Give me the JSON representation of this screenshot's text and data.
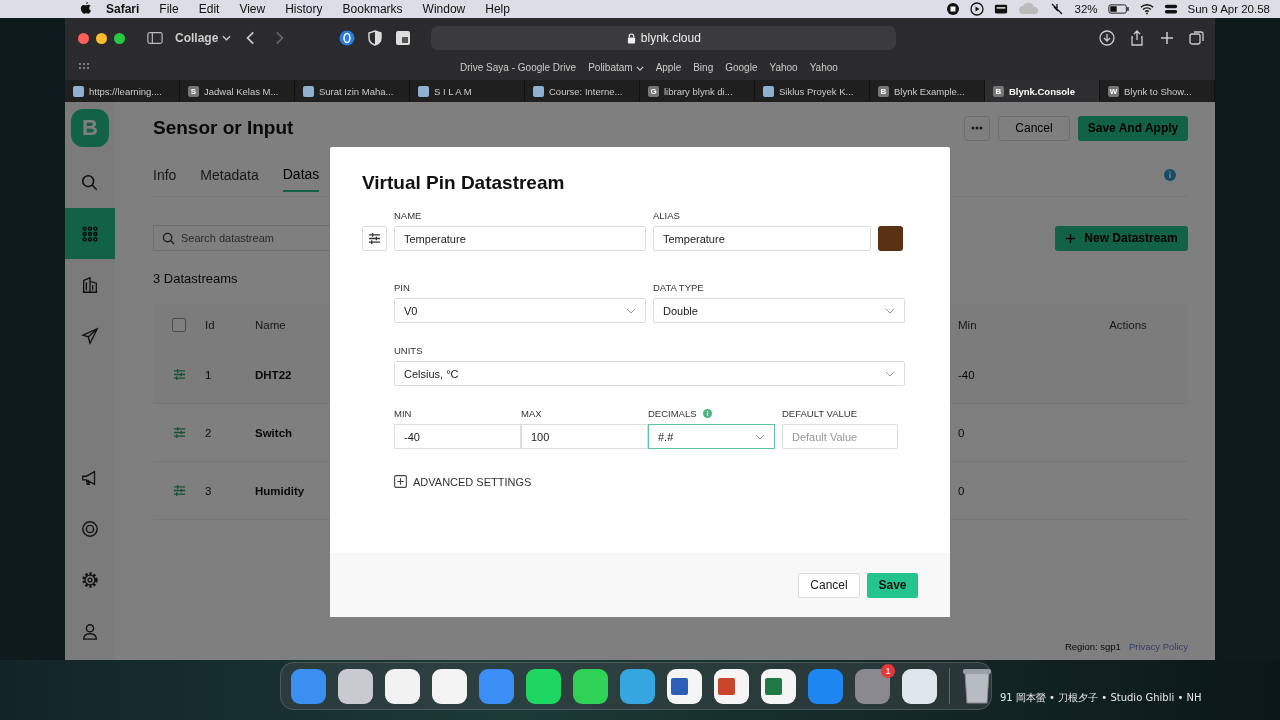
{
  "menu_bar": {
    "app": "Safari",
    "items": [
      "File",
      "Edit",
      "View",
      "History",
      "Bookmarks",
      "Window",
      "Help"
    ],
    "battery": "32%",
    "clock": "Sun 9 Apr 20.58"
  },
  "browser": {
    "profile": "Collage",
    "address": "blynk.cloud",
    "bookmarks": [
      {
        "label": "Drive Saya - Google Drive",
        "kind": "link"
      },
      {
        "label": "Polibatam",
        "kind": "folder"
      },
      {
        "label": "Apple",
        "kind": "link"
      },
      {
        "label": "Bing",
        "kind": "link"
      },
      {
        "label": "Google",
        "kind": "link"
      },
      {
        "label": "Yahoo",
        "kind": "link"
      },
      {
        "label": "Yahoo",
        "kind": "link"
      }
    ],
    "tabs": [
      {
        "label": "https://learning....",
        "selected": false
      },
      {
        "label": "Jadwal Kelas M...",
        "icon_text": "S",
        "selected": false
      },
      {
        "label": "Surat Izin Maha...",
        "selected": false
      },
      {
        "label": "S I L A M",
        "selected": false
      },
      {
        "label": "Course: Interne...",
        "selected": false
      },
      {
        "label": "library blynk di...",
        "icon_text": "G",
        "selected": false
      },
      {
        "label": "Siklus Proyek K...",
        "selected": false
      },
      {
        "label": "Blynk Example...",
        "icon_text": "B",
        "selected": false
      },
      {
        "label": "Blynk.Console",
        "icon_text": "B",
        "selected": true
      },
      {
        "label": "Blynk to Show...",
        "icon_text": "W",
        "selected": false
      }
    ]
  },
  "sidebar": {
    "logo": "B",
    "items": [
      {
        "kind": "search",
        "selected": false
      },
      {
        "kind": "grid",
        "selected": true
      },
      {
        "kind": "building",
        "selected": false
      },
      {
        "kind": "send",
        "selected": false
      },
      {
        "kind": "megaphone",
        "selected": false
      },
      {
        "kind": "lifebuoy",
        "selected": false
      },
      {
        "kind": "gear",
        "selected": false
      },
      {
        "kind": "user",
        "selected": false
      }
    ]
  },
  "page": {
    "title": "Sensor or Input",
    "cancel": "Cancel",
    "save": "Save And Apply",
    "tabs": [
      {
        "label": "Info",
        "selected": false
      },
      {
        "label": "Metadata",
        "selected": false
      },
      {
        "label": "Datas",
        "selected": true
      }
    ],
    "search": {
      "placeholder": "Search datastream"
    },
    "new_button": "New Datastream",
    "count": "3 Datastreams",
    "table": {
      "select_all_checked": false,
      "columns": [
        "Id",
        "Name",
        "Min",
        "Actions"
      ],
      "rows": [
        {
          "id": "1",
          "name": "DHT22",
          "min": "-40"
        },
        {
          "id": "2",
          "name": "Switch",
          "min": "0"
        },
        {
          "id": "3",
          "name": "Humidity",
          "min": "0"
        }
      ]
    },
    "region": "Region: sgp1",
    "privacy": "Privacy Policy"
  },
  "modal": {
    "title": "Virtual Pin Datastream",
    "name_label": "NAME",
    "name": "Temperature",
    "alias_label": "ALIAS",
    "alias": "Temperature",
    "color": "#5a3112",
    "pin_label": "PIN",
    "pin": "V0",
    "type_label": "DATA TYPE",
    "type": "Double",
    "units_label": "UNITS",
    "units": "Celsius, °C",
    "min_label": "MIN",
    "min": "-40",
    "max_label": "MAX",
    "max": "100",
    "decimals_label": "DECIMALS",
    "decimals": "#.#",
    "default_label": "DEFAULT VALUE",
    "default_placeholder": "Default Value",
    "advanced": "ADVANCED SETTINGS",
    "cancel": "Cancel",
    "save": "Save"
  },
  "dock": {
    "apps": [
      {
        "kind": "finder"
      },
      {
        "kind": "launchpad"
      },
      {
        "kind": "chrome"
      },
      {
        "kind": "safari"
      },
      {
        "kind": "mail"
      },
      {
        "kind": "spotify"
      },
      {
        "kind": "whatsapp"
      },
      {
        "kind": "telegram"
      },
      {
        "kind": "word"
      },
      {
        "kind": "powerpoint"
      },
      {
        "kind": "excel"
      },
      {
        "kind": "appstore"
      },
      {
        "kind": "settings",
        "badge": "1"
      },
      {
        "kind": "preview"
      },
      {
        "kind": "trash"
      }
    ]
  },
  "wallpaper_text": "91 岡本螢 • 刀根夕子 • Studio Ghibli • NH"
}
